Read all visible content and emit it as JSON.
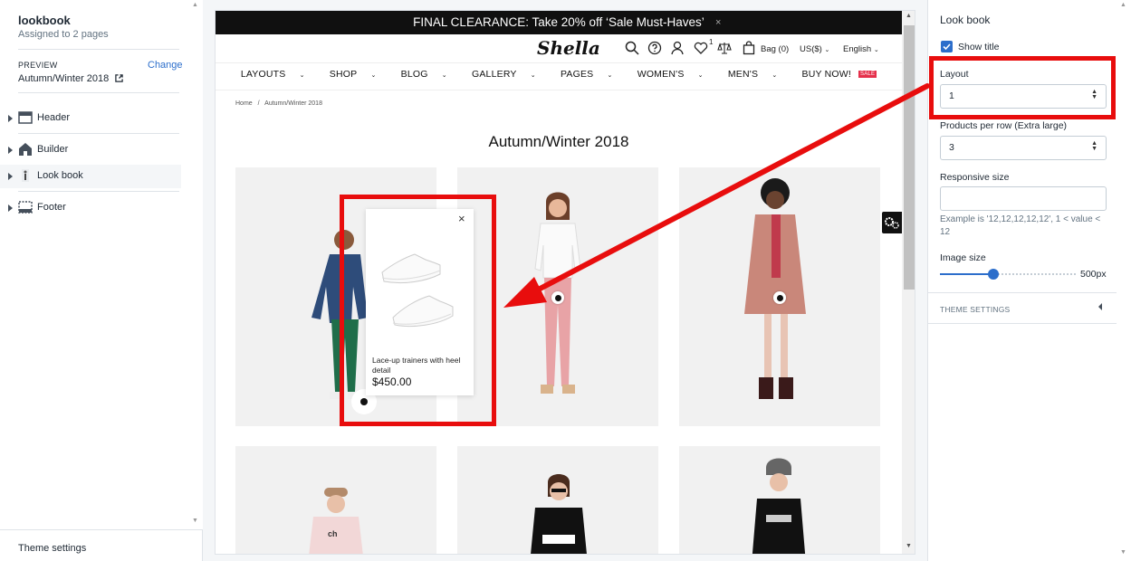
{
  "sidebar": {
    "title": "lookbook",
    "subtitle": "Assigned to 2 pages",
    "preview_label": "PREVIEW",
    "change_link": "Change",
    "preview_value": "Autumn/Winter 2018",
    "sections": [
      {
        "label": "Header",
        "icon": "header-icon"
      },
      {
        "label": "Builder",
        "icon": "home-icon"
      },
      {
        "label": "Look book",
        "icon": "lookbook-icon",
        "active": true
      },
      {
        "label": "Footer",
        "icon": "footer-icon"
      }
    ],
    "theme_settings": "Theme settings"
  },
  "preview": {
    "announcement": "FINAL CLEARANCE: Take 20% off ‘Sale Must-Haves’",
    "announcement_close": "×",
    "logo": "Shella",
    "wishlist_count": "1",
    "bag": "Bag (0)",
    "currency": "US($)",
    "language": "English",
    "nav": [
      "LAYOUTS",
      "SHOP",
      "BLOG",
      "GALLERY",
      "PAGES",
      "WOMEN'S",
      "MEN'S"
    ],
    "nav_buy": "BUY NOW!",
    "nav_sale_badge": "SALE",
    "breadcrumb_home": "Home",
    "breadcrumb_sep": "/",
    "breadcrumb_current": "Autumn/Winter 2018",
    "page_title": "Autumn/Winter 2018",
    "popup": {
      "product_name": "Lace-up trainers with heel detail",
      "price": "$450.00",
      "close": "×"
    }
  },
  "settings": {
    "heading": "Look book",
    "show_title": {
      "label": "Show title",
      "checked": true
    },
    "layout": {
      "label": "Layout",
      "value": "1"
    },
    "products_per_row": {
      "label": "Products per row (Extra large)",
      "value": "3"
    },
    "responsive_size": {
      "label": "Responsive size",
      "value": "",
      "help": "Example is '12,12,12,12,12', 1 < value < 12"
    },
    "image_size": {
      "label": "Image size",
      "value": "500px",
      "fraction": 0.39
    },
    "theme_settings": "THEME SETTINGS"
  },
  "colors": {
    "accent": "#2c6ecb",
    "annotation": "#e80d0d",
    "sale": "#e5304b"
  }
}
